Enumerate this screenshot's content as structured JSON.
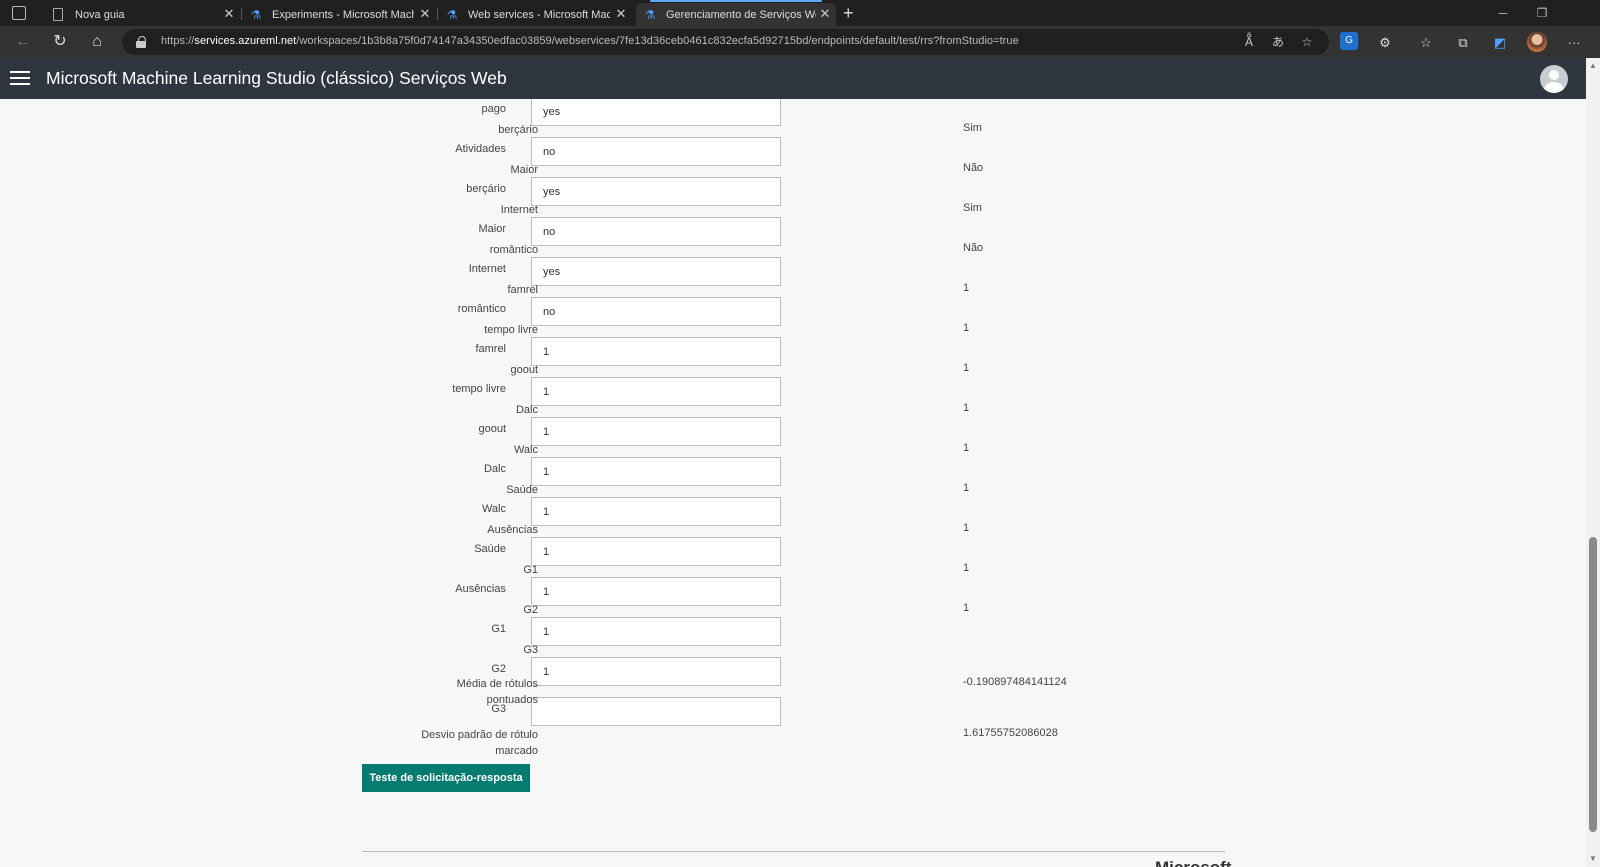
{
  "browser": {
    "tabs": [
      {
        "title": "Nova guia",
        "active": false
      },
      {
        "title": "Experiments - Microsoft Machine",
        "active": false
      },
      {
        "title": "Web services - Microsoft Machine",
        "active": false
      },
      {
        "title": "Gerenciamento de Serviços Web",
        "active": true
      }
    ],
    "url_prefix": "https://",
    "url_host": "services.azureml.net",
    "url_path": "/workspaces/1b3b8a75f0d74147a34350edfac03859/webservices/7fe13d36ceb0461c832ecfa5d92715bd/endpoints/default/test/rrs?fromStudio=true"
  },
  "app": {
    "title": "Microsoft Machine Learning Studio (clássico) Serviços Web"
  },
  "inputs": [
    {
      "label": "pago",
      "value": "yes"
    },
    {
      "label": "Atividades",
      "value": "no"
    },
    {
      "label": "berçário",
      "value": "yes"
    },
    {
      "label": "Maior",
      "value": "no"
    },
    {
      "label": "Internet",
      "value": "yes"
    },
    {
      "label": "romântico",
      "value": "no"
    },
    {
      "label": "famrel",
      "value": "1"
    },
    {
      "label": "tempo livre",
      "value": "1"
    },
    {
      "label": "goout",
      "value": "1"
    },
    {
      "label": "Dalc",
      "value": "1"
    },
    {
      "label": "Walc",
      "value": "1"
    },
    {
      "label": "Saúde",
      "value": "1"
    },
    {
      "label": "Ausências",
      "value": "1"
    },
    {
      "label": "G1",
      "value": "1"
    },
    {
      "label": "G2",
      "value": "1"
    },
    {
      "label": "G3",
      "value": ""
    }
  ],
  "submit_label": "Teste de solicitação-resposta",
  "outputs": [
    {
      "label": "berçário",
      "value": "Sim"
    },
    {
      "label": "Maior",
      "value": "Não"
    },
    {
      "label": "Internet",
      "value": "Sim"
    },
    {
      "label": "romântico",
      "value": "Não"
    },
    {
      "label": "famrel",
      "value": "1"
    },
    {
      "label": "tempo livre",
      "value": "1"
    },
    {
      "label": "goout",
      "value": "1"
    },
    {
      "label": "Dalc",
      "value": "1"
    },
    {
      "label": "Walc",
      "value": "1"
    },
    {
      "label": "Saúde",
      "value": "1"
    },
    {
      "label": "Ausências",
      "value": "1"
    },
    {
      "label": "G1",
      "value": "1"
    },
    {
      "label": "G2",
      "value": "1"
    },
    {
      "label": "G3",
      "value": ""
    },
    {
      "label": "Média de rótulos pontuados",
      "value": "-0.190897484141124"
    },
    {
      "label": "Desvio padrão de rótulo marcado",
      "value": "1.61755752086028"
    }
  ],
  "footer": {
    "brand": "Microsoft"
  },
  "colors": {
    "appbar": "#2f3640",
    "accent_button": "#077b6f",
    "page_bg": "#f7f7f7"
  },
  "icons": [
    "tab-actions-icon",
    "page-icon",
    "flask-icon",
    "close-icon",
    "plus-icon",
    "minimize-icon",
    "restore-icon",
    "back-icon",
    "refresh-icon",
    "home-icon",
    "lock-icon",
    "read-aloud-icon",
    "translate-icon",
    "add-favorite-icon",
    "extension-icon",
    "favorites-icon",
    "collections-icon",
    "more-icon",
    "hamburger-icon",
    "user-avatar-icon"
  ]
}
